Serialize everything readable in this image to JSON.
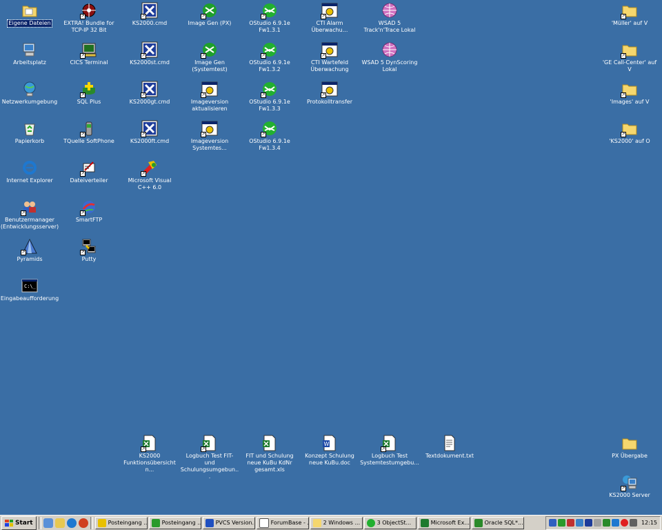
{
  "desktop": {
    "col1": [
      {
        "label": "Eigene Dateien"
      },
      {
        "label": "Arbeitsplatz"
      },
      {
        "label": "Netzwerkumgebung"
      },
      {
        "label": "Papierkorb"
      },
      {
        "label": "Internet Explorer"
      },
      {
        "label": "Benutzermanager (Entwicklungsserver)"
      },
      {
        "label": "Pyramids"
      },
      {
        "label": "Eingabeaufforderung"
      }
    ],
    "col2": [
      {
        "label": "EXTRA! Bundle for TCP-IP 32 Bit"
      },
      {
        "label": "CICS Terminal"
      },
      {
        "label": "SQL Plus"
      },
      {
        "label": "TQuelle SoftPhone"
      },
      {
        "label": "Dateiverteiler"
      },
      {
        "label": "SmartFTP"
      },
      {
        "label": "Putty"
      }
    ],
    "col3": [
      {
        "label": "KS2000.cmd"
      },
      {
        "label": "KS2000st.cmd"
      },
      {
        "label": "KS2000gt.cmd"
      },
      {
        "label": "KS2000ft.cmd"
      },
      {
        "label": "Microsoft Visual C++ 6.0"
      }
    ],
    "col4": [
      {
        "label": "Image Gen (PX)"
      },
      {
        "label": "Image Gen (Systemtest)"
      },
      {
        "label": "Imageversion aktualisieren"
      },
      {
        "label": "Imageversion Systemtes..."
      }
    ],
    "col5": [
      {
        "label": "OStudio 6.9.1e Fw1.3.1"
      },
      {
        "label": "OStudio 6.9.1e Fw1.3.2"
      },
      {
        "label": "OStudio 6.9.1e Fw1.3.3"
      },
      {
        "label": "OStudio 6.9.1e Fw1.3.4"
      }
    ],
    "col6": [
      {
        "label": "CTI Alarm Überwachu..."
      },
      {
        "label": "CTI Wartefeld Überwachung"
      },
      {
        "label": "Protokolltransfer"
      }
    ],
    "col7": [
      {
        "label": "WSAD 5 Track'n'Trace Lokal"
      },
      {
        "label": "WSAD 5 DynScoring Lokal"
      }
    ],
    "right": [
      {
        "label": "'Müller' auf V"
      },
      {
        "label": "'GE Call-Center' auf V"
      },
      {
        "label": "'Images' auf V"
      },
      {
        "label": "'KS2000' auf O"
      }
    ],
    "bottom": [
      {
        "label": "KS2000 Funktionsübersicht n..."
      },
      {
        "label": "Logbuch Test FIT- und Schulungsumgebun..."
      },
      {
        "label": "FIT und Schulung neue KuBu KdNr gesamt.xls"
      },
      {
        "label": "Konzept Schulung neue KuBu.doc"
      },
      {
        "label": "Logbuch Test Systemtestumgebu..."
      },
      {
        "label": "Textdokument.txt"
      }
    ],
    "bottom_right": [
      {
        "label": "PX Übergabe"
      },
      {
        "label": "KS2000 Server"
      }
    ]
  },
  "taskbar": {
    "start_label": "Start",
    "buttons": [
      {
        "label": "Posteingang ..."
      },
      {
        "label": "Posteingang ..."
      },
      {
        "label": "PVCS Version..."
      },
      {
        "label": "ForumBase - ..."
      },
      {
        "label": "2 Windows ..."
      },
      {
        "label": "3 ObjectSt..."
      },
      {
        "label": "Microsoft Ex..."
      },
      {
        "label": "Oracle SQL*..."
      }
    ],
    "clock": "12:15"
  }
}
